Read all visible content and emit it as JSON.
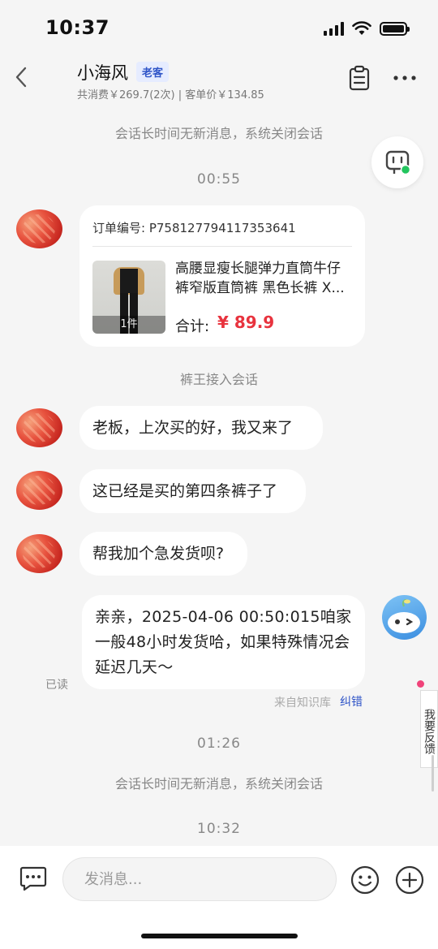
{
  "status_bar": {
    "time": "10:37"
  },
  "header": {
    "title": "小海风",
    "tag": "老客",
    "subtitle": "共消费￥269.7(2次) | 客单价￥134.85",
    "icons": {
      "back": "chevron-left-icon",
      "notes": "clipboard-icon",
      "more": "more-horizontal-icon"
    }
  },
  "conversation": {
    "system_closed_1": "会话长时间无新消息，系统关闭会话",
    "time_1": "00:55",
    "order_card": {
      "order_no": "订单编号: P758127794117353641",
      "product_title": "高腰显瘦长腿弹力直筒牛仔裤窄版直筒裤 黑色长裤 X...",
      "quantity": "1件",
      "total_label": "合计:",
      "total_value": "¥ 89.9"
    },
    "agent_joined": "裤王接入会话",
    "messages": [
      {
        "from": "customer",
        "text": "老板，上次买的好，我又来了"
      },
      {
        "from": "customer",
        "text": "这已经是买的第四条裤子了"
      },
      {
        "from": "customer",
        "text": "帮我加个急发货呗?"
      }
    ],
    "bot_reply": {
      "text": "亲亲，2025-04-06 00:50:015咱家一般48小时发货哈，如果特殊情况会延迟几天～",
      "read_status": "已读",
      "source": "来自知识库",
      "correct_link": "纠错"
    },
    "time_2": "01:26",
    "system_closed_2": "会话长时间无新消息，系统关闭会话",
    "time_3": "10:32"
  },
  "feedback_tab": "我要反馈",
  "input_bar": {
    "placeholder": "发消息...",
    "icons": {
      "menu": "chat-menu-icon",
      "emoji": "emoji-icon",
      "plus": "plus-circle-icon"
    }
  },
  "colors": {
    "price_red": "#e8333e",
    "link_blue": "#2f54c7",
    "online_green": "#22c55e",
    "background": "#f5f5f5"
  }
}
